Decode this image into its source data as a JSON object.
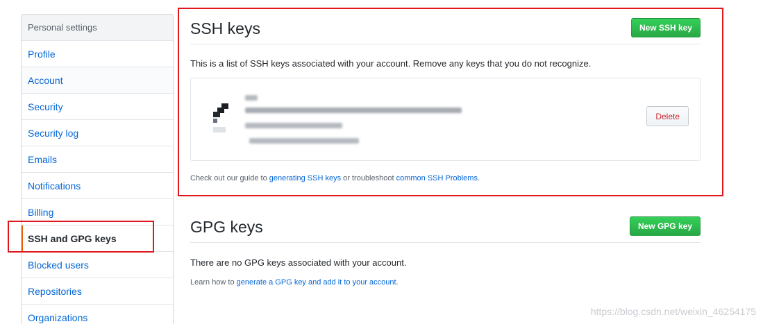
{
  "sidebar": {
    "header": "Personal settings",
    "items": [
      {
        "label": "Profile"
      },
      {
        "label": "Account"
      },
      {
        "label": "Security"
      },
      {
        "label": "Security log"
      },
      {
        "label": "Emails"
      },
      {
        "label": "Notifications"
      },
      {
        "label": "Billing"
      },
      {
        "label": "SSH and GPG keys"
      },
      {
        "label": "Blocked users"
      },
      {
        "label": "Repositories"
      },
      {
        "label": "Organizations"
      }
    ],
    "active_item": "SSH and GPG keys"
  },
  "ssh": {
    "title": "SSH keys",
    "new_button": "New SSH key",
    "description": "This is a list of SSH keys associated with your account. Remove any keys that you do not recognize.",
    "delete_button": "Delete",
    "guide_prefix": "Check out our guide to ",
    "guide_link1": "generating SSH keys",
    "guide_middle": " or troubleshoot ",
    "guide_link2": "common SSH Problems",
    "guide_suffix": "."
  },
  "gpg": {
    "title": "GPG keys",
    "new_button": "New GPG key",
    "empty_text": "There are no GPG keys associated with your account.",
    "learn_prefix": "Learn how to ",
    "learn_link": "generate a GPG key and add it to your account",
    "learn_suffix": "."
  },
  "watermark": "https://blog.csdn.net/weixin_46254175",
  "colors": {
    "link": "#0366d6",
    "green_button": "#28a745",
    "highlight": "#e0161d",
    "active_border": "#e36209",
    "delete_text": "#cb2431"
  }
}
